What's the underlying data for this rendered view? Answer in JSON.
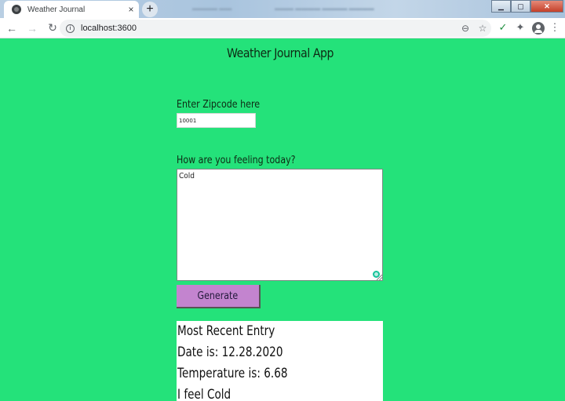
{
  "browser": {
    "tab_title": "Weather Journal",
    "tab_close": "×",
    "new_tab": "+",
    "url": "localhost:3600",
    "window_controls": {
      "minimize": "▁",
      "maximize": "▢",
      "close": "✕"
    },
    "icons": {
      "back": "←",
      "forward": "→",
      "reload": "↻",
      "info": "i",
      "zoom": "⊖",
      "bookmark": "☆",
      "extension_1": "✓",
      "extensions": "✦",
      "menu": "⋮"
    }
  },
  "app": {
    "title": "Weather Journal App",
    "zip_label": "Enter Zipcode here",
    "zip_value": "10001",
    "feelings_label": "How are you feeling today?",
    "feelings_value": "Cold",
    "generate_label": "Generate",
    "entry": {
      "heading": "Most Recent Entry",
      "date": "Date is: 12.28.2020",
      "temp": "Temperature is: 6.68",
      "content": "I feel Cold"
    }
  }
}
